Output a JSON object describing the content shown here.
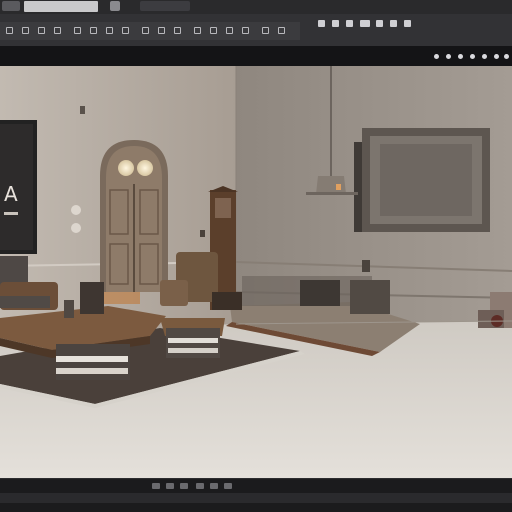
{
  "window": {
    "tab_title": "",
    "colors": {
      "chrome_dark": "#1e1e20",
      "toolbar": "#323235",
      "viewport_floor": "#dcd8d2",
      "wall": "#b9b1a8",
      "wood": "#6b4a30"
    }
  },
  "toolbar": {
    "icons": [
      "select-icon",
      "move-icon",
      "rotate-icon",
      "scale-icon",
      "snap-icon",
      "grid-icon",
      "camera-icon",
      "light-icon",
      "material-icon",
      "render-icon",
      "settings-icon"
    ]
  },
  "viewport": {
    "scene": "3d-room-interior",
    "tv_screen_text": "A",
    "view_mode": ""
  },
  "statusbar": {
    "icons": [
      "play-icon",
      "pause-icon",
      "stop-icon",
      "frame-icon",
      "timeline-icon",
      "record-icon"
    ]
  }
}
